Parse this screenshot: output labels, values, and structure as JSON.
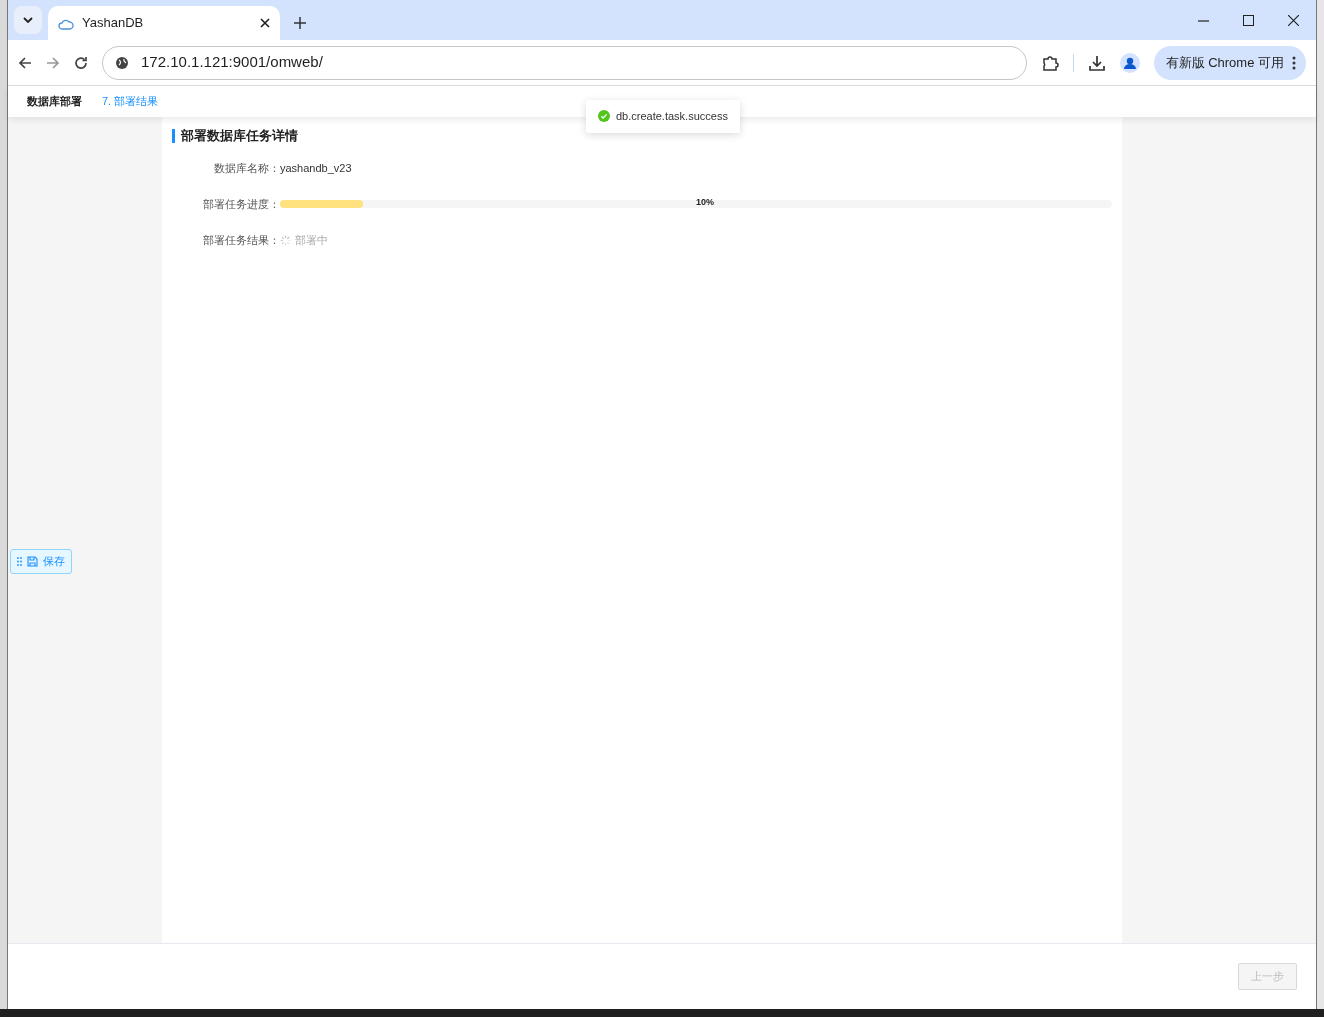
{
  "browser": {
    "tab_title": "YashanDB",
    "url": "172.10.1.121:9001/omweb/",
    "update_button": "有新版 Chrome 可用"
  },
  "breadcrumb": [
    {
      "label": "数据库部署",
      "selected": false
    },
    {
      "label": "7. 部署结果",
      "selected": true
    }
  ],
  "toast": {
    "message": "db.create.task.success",
    "kind": "success"
  },
  "section": {
    "title": "部署数据库任务详情",
    "fields": [
      {
        "kind": "text",
        "label": "数据库名称：",
        "value": "yashandb_v23"
      },
      {
        "kind": "progress",
        "label": "部署任务进度：",
        "level": 0.1,
        "reading": "10%"
      },
      {
        "kind": "status",
        "label": "部署任务结果：",
        "value": "部署中",
        "loading": true
      }
    ]
  },
  "save_button": "保存",
  "footer": {
    "prev_button": {
      "label": "上一步",
      "disabled": true
    }
  }
}
